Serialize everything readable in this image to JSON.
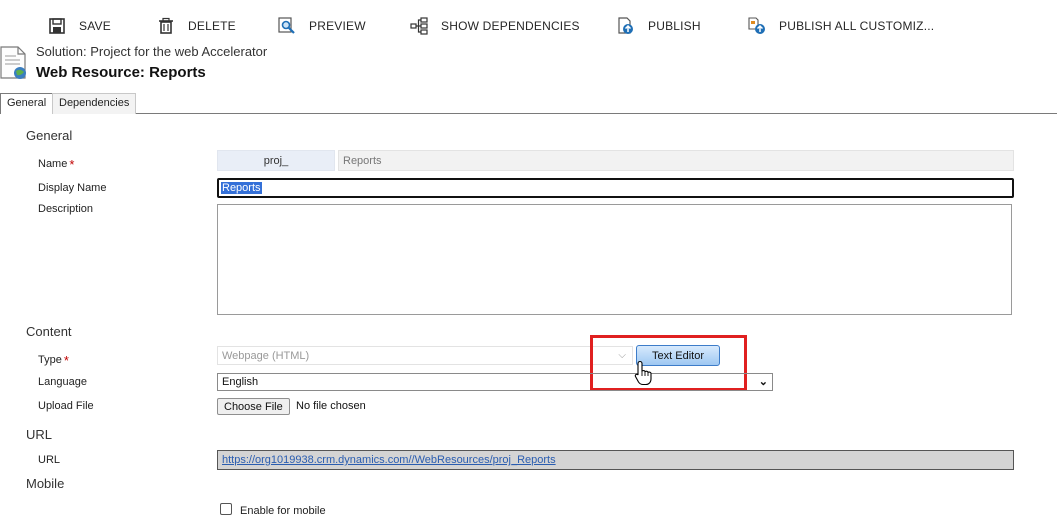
{
  "toolbar": {
    "save": "SAVE",
    "delete": "DELETE",
    "preview": "PREVIEW",
    "show_dependencies": "SHOW DEPENDENCIES",
    "publish": "PUBLISH",
    "publish_all": "PUBLISH ALL CUSTOMIZ..."
  },
  "header": {
    "solution": "Solution: Project for the web Accelerator",
    "title": "Web Resource: Reports"
  },
  "tabs": [
    "General",
    "Dependencies"
  ],
  "general": {
    "section": "General",
    "name_label": "Name",
    "name_prefix": "proj_",
    "name_value": "Reports",
    "display_name_label": "Display Name",
    "display_name_value": "Reports",
    "description_label": "Description"
  },
  "content": {
    "section": "Content",
    "type_label": "Type",
    "type_value": "Webpage (HTML)",
    "text_editor_button": "Text Editor",
    "language_label": "Language",
    "language_value": "English",
    "upload_label": "Upload File",
    "choose_file_button": "Choose File",
    "no_file_text": "No file chosen"
  },
  "url": {
    "section": "URL",
    "url_label": "URL",
    "url_value": "https://org1019938.crm.dynamics.com//WebResources/proj_Reports"
  },
  "mobile": {
    "section": "Mobile",
    "enable_label": "Enable for mobile"
  },
  "icons": {
    "save": "save-icon",
    "delete": "trash-icon",
    "preview": "preview-icon",
    "dependencies": "dependencies-icon",
    "publish": "publish-icon",
    "publish_all": "publish-all-icon",
    "document": "web-resource-document-icon"
  },
  "colors": {
    "highlight": "#e02020",
    "link": "#2a5db0",
    "required": "#c00000"
  }
}
